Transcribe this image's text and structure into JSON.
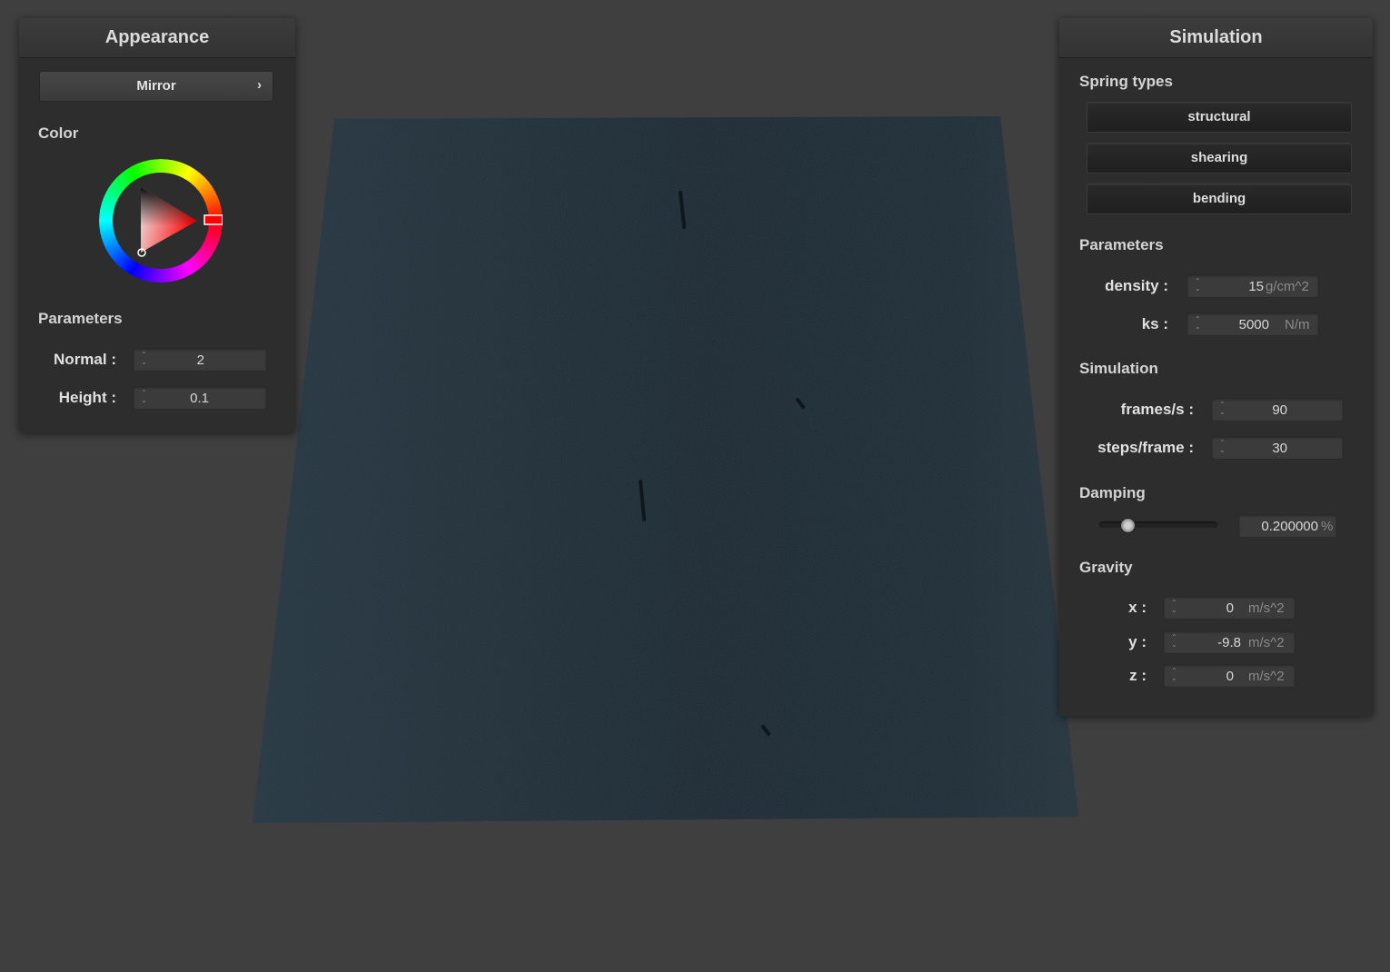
{
  "appearance_panel": {
    "title": "Appearance",
    "shader_select": {
      "value": "Mirror",
      "icon": "chevron-right-icon"
    },
    "color_section": "Color",
    "color_wheel": {
      "selected_hue_color": "#ff0000"
    },
    "parameters_section": "Parameters",
    "normal": {
      "label": "Normal :",
      "value": "2"
    },
    "height": {
      "label": "Height :",
      "value": "0.1"
    }
  },
  "simulation_panel": {
    "title": "Simulation",
    "spring_types_section": "Spring types",
    "spring_buttons": [
      "structural",
      "shearing",
      "bending"
    ],
    "parameters_section": "Parameters",
    "density": {
      "label": "density :",
      "value": "15",
      "unit": "g/cm^2"
    },
    "ks": {
      "label": "ks :",
      "value": "5000",
      "unit": "N/m"
    },
    "simulation_section": "Simulation",
    "frames_per_s": {
      "label": "frames/s :",
      "value": "90"
    },
    "steps_per_frame": {
      "label": "steps/frame :",
      "value": "30"
    },
    "damping_section": "Damping",
    "damping": {
      "value": "0.200000",
      "unit": "%",
      "slider_fraction": 0.2
    },
    "gravity_section": "Gravity",
    "gravity": [
      {
        "label": "x :",
        "value": "0",
        "unit": "m/s^2"
      },
      {
        "label": "y :",
        "value": "-9.8",
        "unit": "m/s^2"
      },
      {
        "label": "z :",
        "value": "0",
        "unit": "m/s^2"
      }
    ]
  },
  "colors": {
    "background": "#3f3f3f",
    "panel": "#2d2d2d",
    "cloth": "#1d2a33"
  }
}
